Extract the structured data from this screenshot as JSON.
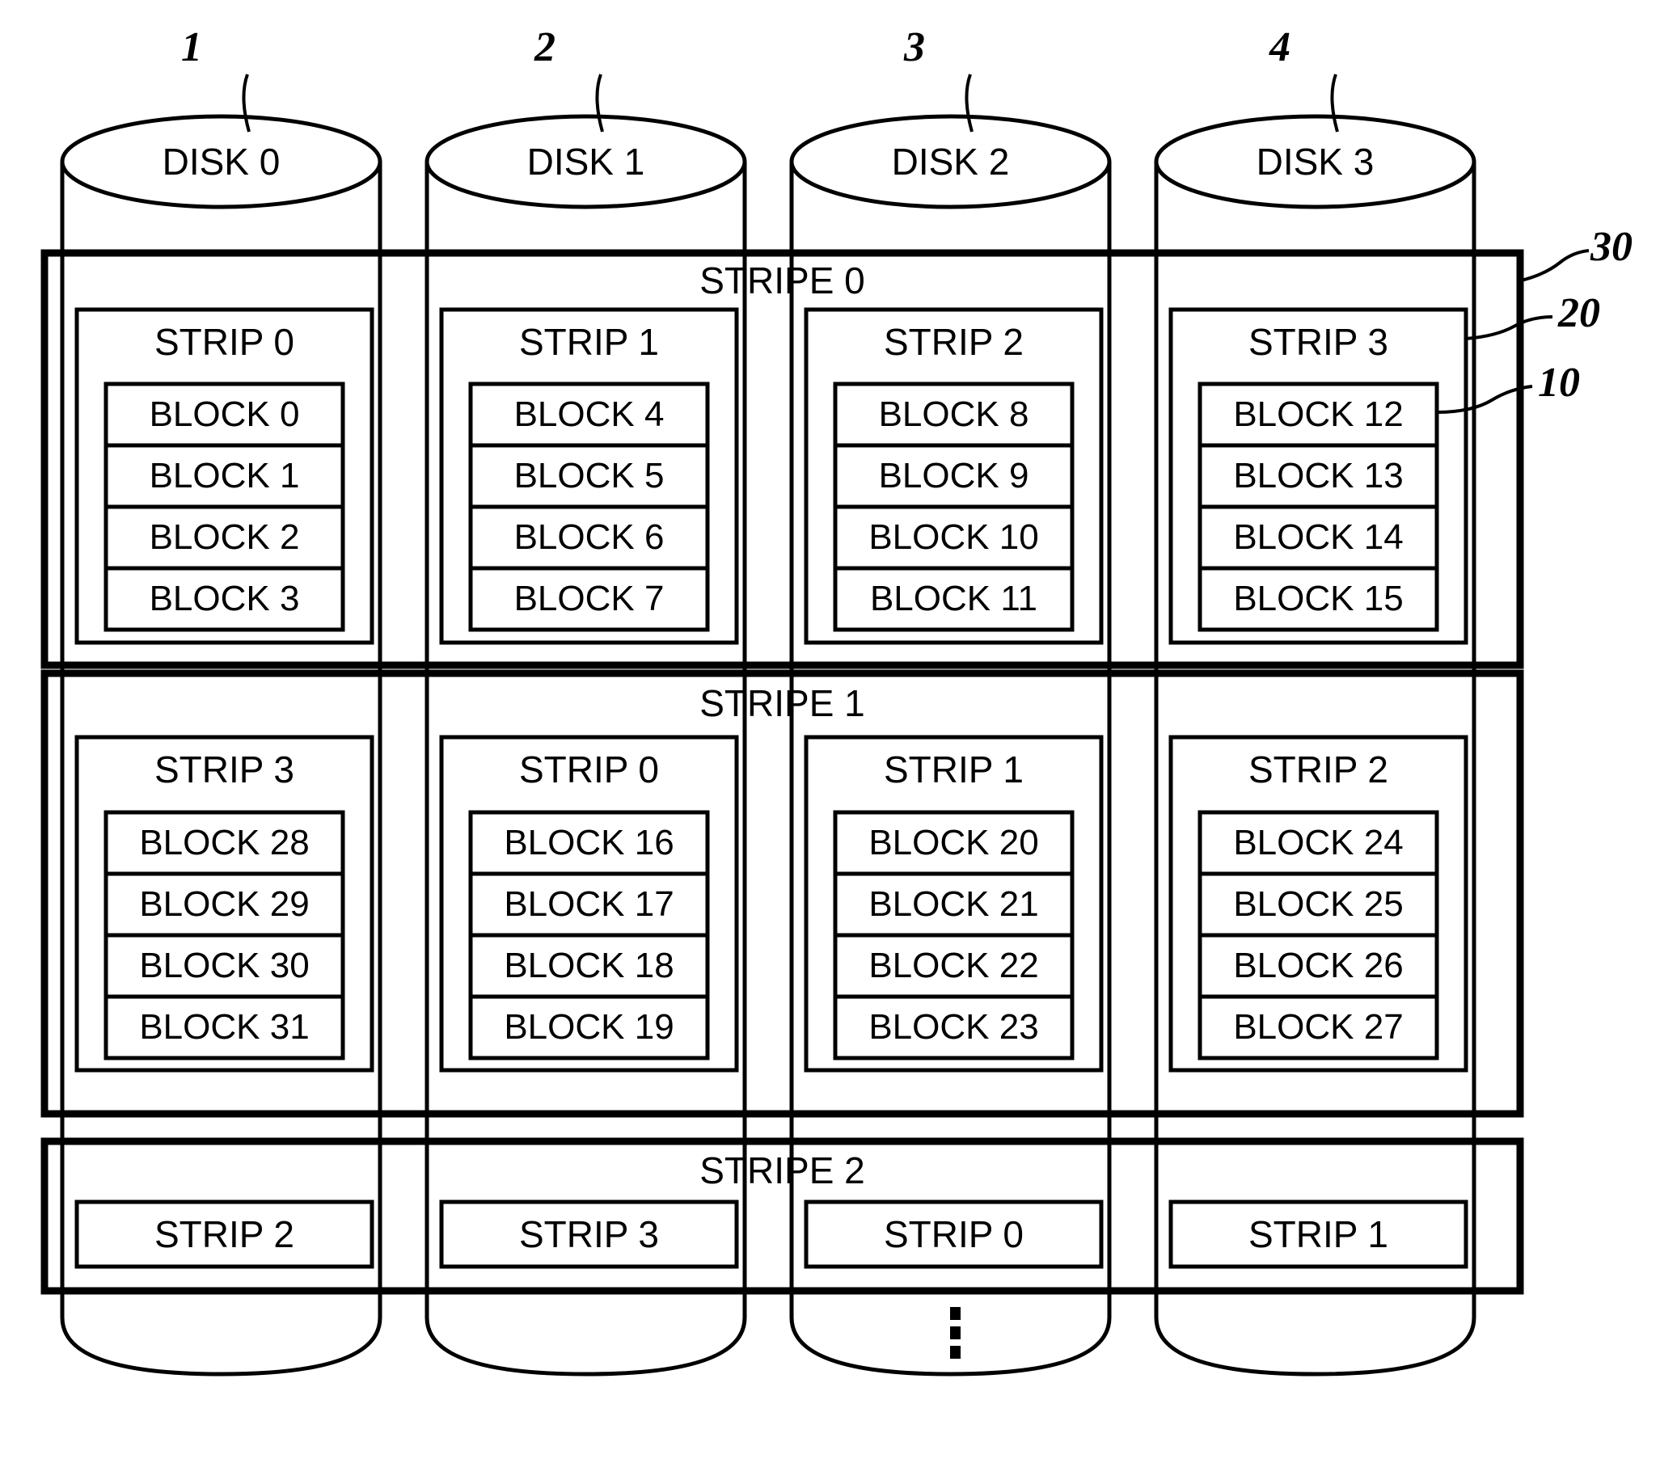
{
  "figure": {
    "title": "RAID disk array stripe and strip layout diagram",
    "line_color": "#000000",
    "background_color": "#ffffff"
  },
  "disks": [
    {
      "label": "DISK 0",
      "ref": "1"
    },
    {
      "label": "DISK 1",
      "ref": "2"
    },
    {
      "label": "DISK 2",
      "ref": "3"
    },
    {
      "label": "DISK 3",
      "ref": "4"
    }
  ],
  "reference_numerals": [
    {
      "id": "30",
      "label": "30",
      "points_to": "stripe"
    },
    {
      "id": "20",
      "label": "20",
      "points_to": "strip"
    },
    {
      "id": "10",
      "label": "10",
      "points_to": "block"
    }
  ],
  "stripes": [
    {
      "label": "STRIPE 0",
      "strips": [
        {
          "label": "STRIP 0",
          "blocks": [
            "BLOCK 0",
            "BLOCK 1",
            "BLOCK 2",
            "BLOCK 3"
          ]
        },
        {
          "label": "STRIP 1",
          "blocks": [
            "BLOCK 4",
            "BLOCK 5",
            "BLOCK 6",
            "BLOCK 7"
          ]
        },
        {
          "label": "STRIP 2",
          "blocks": [
            "BLOCK 8",
            "BLOCK 9",
            "BLOCK 10",
            "BLOCK 11"
          ]
        },
        {
          "label": "STRIP 3",
          "blocks": [
            "BLOCK 12",
            "BLOCK 13",
            "BLOCK 14",
            "BLOCK 15"
          ]
        }
      ]
    },
    {
      "label": "STRIPE 1",
      "strips": [
        {
          "label": "STRIP 3",
          "blocks": [
            "BLOCK 28",
            "BLOCK 29",
            "BLOCK 30",
            "BLOCK 31"
          ]
        },
        {
          "label": "STRIP 0",
          "blocks": [
            "BLOCK 16",
            "BLOCK 17",
            "BLOCK 18",
            "BLOCK 19"
          ]
        },
        {
          "label": "STRIP 1",
          "blocks": [
            "BLOCK 20",
            "BLOCK 21",
            "BLOCK 22",
            "BLOCK 23"
          ]
        },
        {
          "label": "STRIP 2",
          "blocks": [
            "BLOCK 24",
            "BLOCK 25",
            "BLOCK 26",
            "BLOCK 27"
          ]
        }
      ]
    },
    {
      "label": "STRIPE 2",
      "strips": [
        {
          "label": "STRIP 2",
          "blocks": []
        },
        {
          "label": "STRIP 3",
          "blocks": []
        },
        {
          "label": "STRIP 0",
          "blocks": []
        },
        {
          "label": "STRIP 1",
          "blocks": []
        }
      ]
    }
  ],
  "continuation": {
    "symbol": "vertical-ellipsis",
    "dots": 3
  }
}
